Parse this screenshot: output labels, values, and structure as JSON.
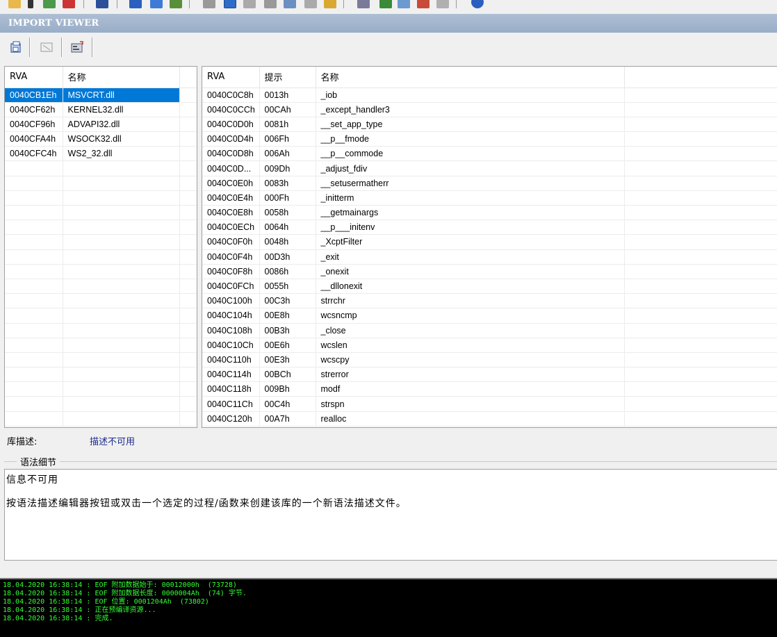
{
  "panel_title": "IMPORT VIEWER",
  "left_table": {
    "headers": [
      "RVA",
      "名称"
    ],
    "rows": [
      [
        "0040CB1Eh",
        "MSVCRT.dll"
      ],
      [
        "0040CF62h",
        "KERNEL32.dll"
      ],
      [
        "0040CF96h",
        "ADVAPI32.dll"
      ],
      [
        "0040CFA4h",
        "WSOCK32.dll"
      ],
      [
        "0040CFC4h",
        "WS2_32.dll"
      ]
    ],
    "selected_index": 0
  },
  "right_table": {
    "headers": [
      "RVA",
      "提示",
      "名称"
    ],
    "rows": [
      [
        "0040C0C8h",
        "0013h",
        "_iob"
      ],
      [
        "0040C0CCh",
        "00CAh",
        "_except_handler3"
      ],
      [
        "0040C0D0h",
        "0081h",
        "__set_app_type"
      ],
      [
        "0040C0D4h",
        "006Fh",
        "__p__fmode"
      ],
      [
        "0040C0D8h",
        "006Ah",
        "__p__commode"
      ],
      [
        "0040C0D...",
        "009Dh",
        "_adjust_fdiv"
      ],
      [
        "0040C0E0h",
        "0083h",
        "__setusermatherr"
      ],
      [
        "0040C0E4h",
        "000Fh",
        "_initterm"
      ],
      [
        "0040C0E8h",
        "0058h",
        "__getmainargs"
      ],
      [
        "0040C0ECh",
        "0064h",
        "__p___initenv"
      ],
      [
        "0040C0F0h",
        "0048h",
        "_XcptFilter"
      ],
      [
        "0040C0F4h",
        "00D3h",
        "_exit"
      ],
      [
        "0040C0F8h",
        "0086h",
        "_onexit"
      ],
      [
        "0040C0FCh",
        "0055h",
        "__dllonexit"
      ],
      [
        "0040C100h",
        "00C3h",
        "strrchr"
      ],
      [
        "0040C104h",
        "00E8h",
        "wcsncmp"
      ],
      [
        "0040C108h",
        "00B3h",
        "_close"
      ],
      [
        "0040C10Ch",
        "00E6h",
        "wcslen"
      ],
      [
        "0040C110h",
        "00E3h",
        "wcscpy"
      ],
      [
        "0040C114h",
        "00BCh",
        "strerror"
      ],
      [
        "0040C118h",
        "009Bh",
        "modf"
      ],
      [
        "0040C11Ch",
        "00C4h",
        "strspn"
      ],
      [
        "0040C120h",
        "00A7h",
        "realloc"
      ]
    ]
  },
  "library_description": {
    "label": "库描述:",
    "value": "描述不可用"
  },
  "syntax_details": {
    "title": "语法细节",
    "line1": "信息不可用",
    "line2": "按语法描述编辑器按钮或双击一个选定的过程/函数来创建该库的一个新语法描述文件。"
  },
  "log_lines": [
    "18.04.2020 16:38:14 : EOF 附加数据始于: 00012000h  (73728)",
    "18.04.2020 16:38:14 : EOF 附加数据长度: 0000004Ah  (74) 字节.",
    "18.04.2020 16:38:14 : EOF 位置: 0001204Ah  (73802)",
    "18.04.2020 16:38:14 : 正在预编译资源...",
    "18.04.2020 16:38:14 : 完成."
  ],
  "colors": {
    "title_bar": "#98adc7",
    "selection": "#0078d7",
    "log_text": "#33ff33",
    "description_value": "#1c2a8a"
  }
}
